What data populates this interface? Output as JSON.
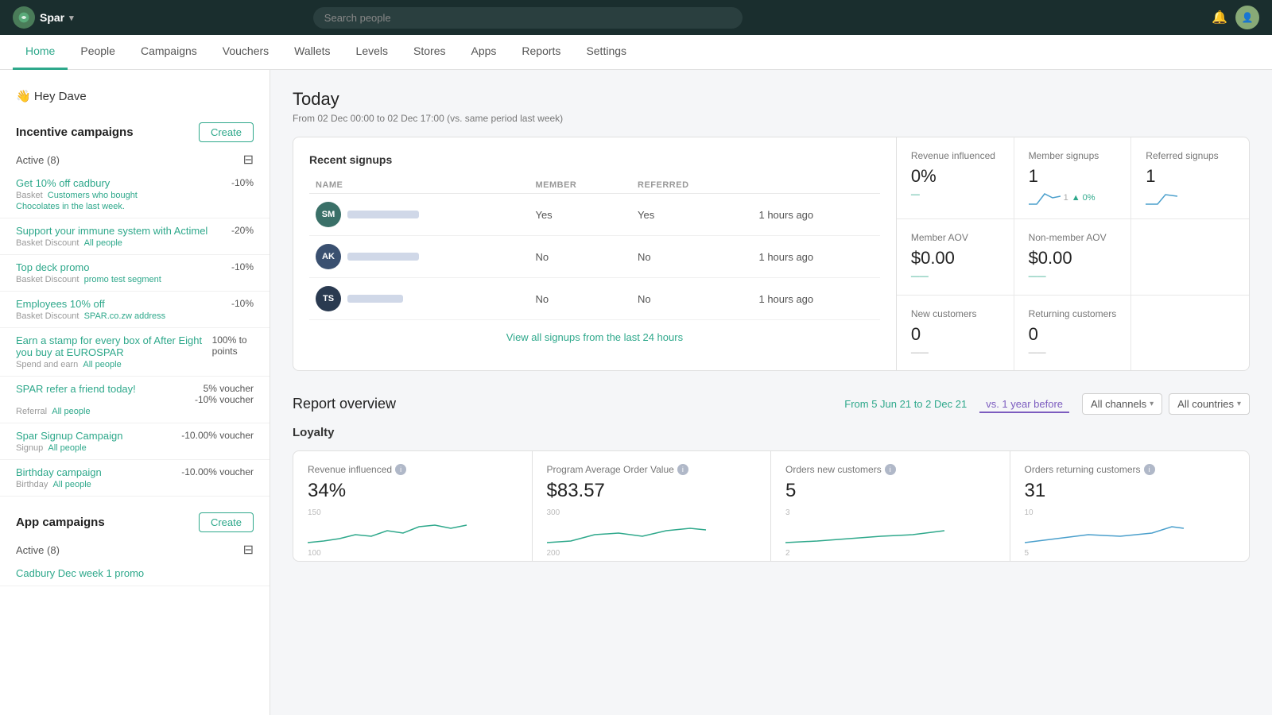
{
  "app": {
    "logo_text": "Spar",
    "chevron": "▾"
  },
  "topbar": {
    "search_placeholder": "Search people",
    "bell": "🔔"
  },
  "nav": {
    "tabs": [
      "Home",
      "People",
      "Campaigns",
      "Vouchers",
      "Wallets",
      "Levels",
      "Stores",
      "Apps",
      "Reports",
      "Settings"
    ],
    "active": "Home"
  },
  "sidebar": {
    "greeting": "👋 Hey Dave",
    "incentive_section": "Incentive campaigns",
    "app_section": "App campaigns",
    "create_label": "Create",
    "active_count": "Active (8)",
    "active_count2": "Active (8)",
    "campaigns": [
      {
        "name": "Get 10% off cadbury",
        "type": "Basket",
        "segment": "Customers who bought",
        "sub": "Chocolates in the last week.",
        "discount": "-10%"
      },
      {
        "name": "Support your immune system with Actimel",
        "type": "Basket Discount",
        "segment": "All people",
        "sub": "",
        "discount": "-20%"
      },
      {
        "name": "Top deck promo",
        "type": "Basket Discount",
        "segment": "promo test segment",
        "sub": "",
        "discount": "-10%"
      },
      {
        "name": "Employees 10% off",
        "type": "Basket Discount",
        "segment": "SPAR.co.zw address",
        "sub": "",
        "discount": "-10%"
      },
      {
        "name": "Earn a stamp for every box of After Eight you buy at EUROSPAR",
        "type": "Spend and earn",
        "segment": "All people",
        "sub": "",
        "discount": "100% to points"
      },
      {
        "name": "SPAR refer a friend today!",
        "type": "Referral",
        "segment": "All people",
        "sub": "",
        "discount": "5% voucher\n-10% voucher"
      },
      {
        "name": "Spar Signup Campaign",
        "type": "Signup",
        "segment": "All people",
        "sub": "",
        "discount": "-10.00% voucher"
      },
      {
        "name": "Birthday campaign",
        "type": "Birthday",
        "segment": "All people",
        "sub": "",
        "discount": "-10.00% voucher"
      }
    ],
    "app_campaigns": [
      {
        "name": "Cadbury Dec week 1 promo",
        "type": "",
        "segment": "",
        "sub": "",
        "discount": ""
      }
    ]
  },
  "today": {
    "title": "Today",
    "subtitle": "From 02 Dec 00:00 to 02 Dec 17:00 (vs. same period last week)",
    "recent_signups": "Recent signups",
    "table_headers": [
      "NAME",
      "MEMBER",
      "REFERRED"
    ],
    "signups": [
      {
        "initials": "SM",
        "color": "#3a7068",
        "member": "Yes",
        "referred": "Yes",
        "time": "1 hours ago"
      },
      {
        "initials": "AK",
        "color": "#3a5070",
        "member": "No",
        "referred": "No",
        "time": "1 hours ago"
      },
      {
        "initials": "TS",
        "color": "#2a3a50",
        "member": "No",
        "referred": "No",
        "time": "1 hours ago"
      }
    ],
    "view_all": "View all signups from the last 24 hours",
    "stats": [
      {
        "label": "Revenue influenced",
        "value": "0%",
        "trend": "—"
      },
      {
        "label": "Member signups",
        "value": "1",
        "trend": "1 ▲ 0%"
      },
      {
        "label": "Referred signups",
        "value": "1",
        "trend": ""
      },
      {
        "label": "Member AOV",
        "value": "$0.00",
        "trend": ""
      },
      {
        "label": "Non-member AOV",
        "value": "$0.00",
        "trend": ""
      },
      {
        "label": "",
        "value": "",
        "trend": ""
      },
      {
        "label": "New customers",
        "value": "0",
        "trend": ""
      },
      {
        "label": "Returning customers",
        "value": "0",
        "trend": ""
      },
      {
        "label": "",
        "value": "",
        "trend": ""
      }
    ]
  },
  "report": {
    "title": "Report overview",
    "date_from": "From 5 Jun 21 to 2 Dec 21",
    "vs_label": "vs. 1 year before",
    "channels_label": "All channels",
    "countries_label": "All countries",
    "loyalty_title": "Loyalty",
    "metrics": [
      {
        "label": "Revenue influenced",
        "value": "34%",
        "chart_max": 150,
        "chart_mid": 100
      },
      {
        "label": "Program Average Order Value",
        "value": "$83.57",
        "chart_max": 300,
        "chart_mid": 200
      },
      {
        "label": "Orders new customers",
        "value": "5",
        "chart_max": 3,
        "chart_mid": 2
      },
      {
        "label": "Orders returning customers",
        "value": "31",
        "chart_max": 10,
        "chart_mid": 5
      }
    ]
  }
}
